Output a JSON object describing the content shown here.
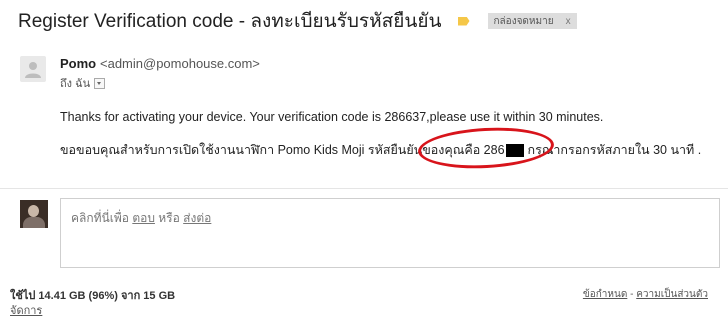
{
  "email": {
    "subject": "Register Verification code - ลงทะเบียนรับรหัสยืนยัน",
    "label": "กล่องจดหมาย",
    "label_remove": "x",
    "sender_name": "Pomo",
    "sender_email": "<admin@pomohouse.com>",
    "to_text": "ถึง ฉัน",
    "body_line1": "Thanks for activating your device. Your verification code is 286637,please use it within 30 minutes.",
    "body_line2_before": "ขอขอบคุณสำหรับการเปิดใช้งานนาฬิกา Pomo Kids Moji รหัสยืนยันของคุณคือ 286",
    "body_line2_after": "กรุณากรอกรหัสภายใน 30 นาที ."
  },
  "reply": {
    "prefix": "คลิกที่นี่เพื่อ ",
    "reply_link": "ตอบ",
    "middle": " หรือ ",
    "forward_link": "ส่งต่อ"
  },
  "footer": {
    "storage": "ใช้ไป 14.41 GB (96%) จาก 15 GB",
    "manage": "จัดการ",
    "terms": "ข้อกำหนด",
    "separator": " - ",
    "privacy": "ความเป็นส่วนตัว"
  },
  "colors": {
    "annotation": "#d8141b",
    "important_marker": "#f5c748"
  },
  "icons": {
    "avatar": "person-placeholder-icon",
    "dropdown": "chevron-down-icon",
    "marker": "important-marker-icon"
  }
}
